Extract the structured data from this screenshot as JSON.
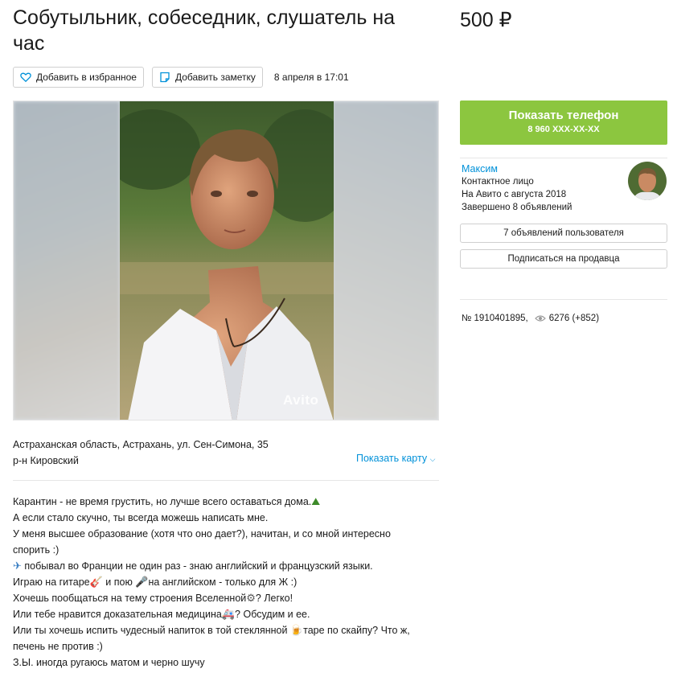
{
  "listing": {
    "title": "Собутыльник, собеседник, слушатель на час",
    "price": "500 ₽",
    "favorite_label": "Добавить в избранное",
    "note_label": "Добавить заметку",
    "posted_date": "8 апреля в 17:01",
    "photo_watermark": "Avito"
  },
  "location": {
    "address": "Астраханская область, Астрахань, ул. Сен-Симона, 35",
    "district": "р-н Кировский",
    "map_link": "Показать карту"
  },
  "description": {
    "lines": [
      "Карантин - не время грустить, но лучше всего оставаться дома.",
      "А если стало скучно, ты всегда можешь написать мне.",
      "У меня высшее образование (хотя что оно дает?), начитан, и со мной интересно",
      "спорить :)",
      " побывал во Франции не один раз - знаю английский и французский языки.",
      "Играю на гитаре",
      " и пою ",
      "на английском - только для Ж :)",
      "Хочешь пообщаться на тему строения Вселенной",
      "? Легко!",
      "Или тебе нравится доказательная медицина",
      "? Обсудим и ее.",
      "Или ты хочешь испить чудесный напиток в той стеклянной ",
      "таре по скайпу? Что ж,",
      "печень не против :)",
      "З.Ы. иногда ругаюсь матом и черно шучу"
    ],
    "emoji": {
      "house": "⛰",
      "plane": "✈",
      "guitar": "🎸",
      "mic": "🎤",
      "cosmos": "⚙",
      "ambulance": "🚑",
      "beer": "🍺"
    }
  },
  "contact": {
    "phone_button": "Показать телефон",
    "phone_masked": "8 960 XXX-XX-XX",
    "seller_name": "Максим",
    "seller_type": "Контактное лицо",
    "member_since": "На Авито с августа 2018",
    "completed": "Завершено 8 объявлений",
    "user_ads_button": "7 объявлений пользователя",
    "subscribe_button": "Подписаться на продавца",
    "ad_number": "№ 1910401895,",
    "views": "6276 (+852)"
  },
  "colors": {
    "accent_green": "#8cc63f",
    "link_blue": "#0091d9"
  }
}
